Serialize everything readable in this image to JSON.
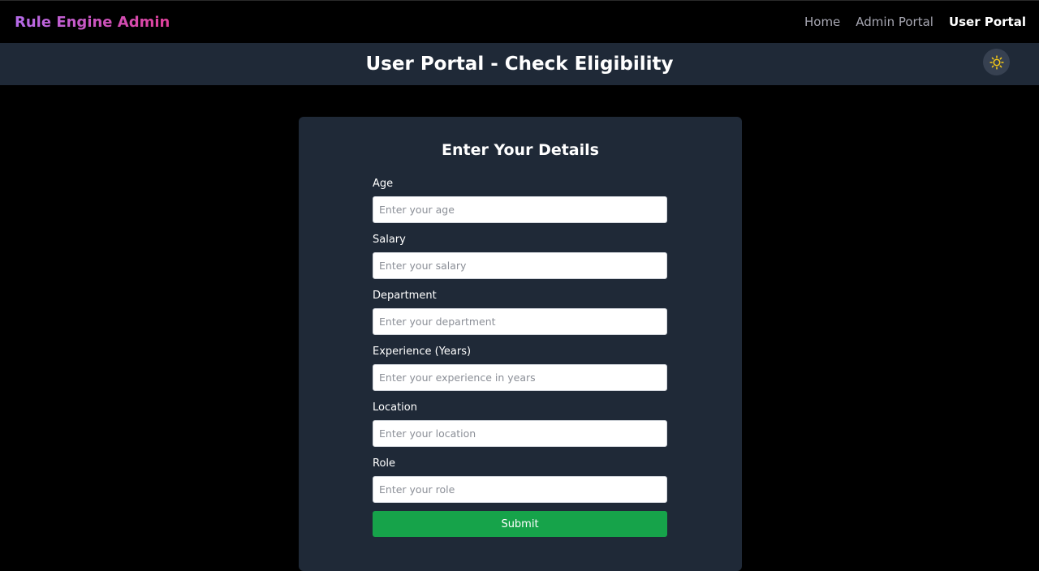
{
  "navbar": {
    "brand": "Rule Engine Admin",
    "links": [
      {
        "label": "Home",
        "active": false
      },
      {
        "label": "Admin Portal",
        "active": false
      },
      {
        "label": "User Portal",
        "active": true
      }
    ]
  },
  "header": {
    "title": "User Portal - Check Eligibility",
    "theme_icon": "sun-icon"
  },
  "form": {
    "title": "Enter Your Details",
    "fields": [
      {
        "label": "Age",
        "placeholder": "Enter your age",
        "value": ""
      },
      {
        "label": "Salary",
        "placeholder": "Enter your salary",
        "value": ""
      },
      {
        "label": "Department",
        "placeholder": "Enter your department",
        "value": ""
      },
      {
        "label": "Experience (Years)",
        "placeholder": "Enter your experience in years",
        "value": ""
      },
      {
        "label": "Location",
        "placeholder": "Enter your location",
        "value": ""
      },
      {
        "label": "Role",
        "placeholder": "Enter your role",
        "value": ""
      }
    ],
    "submit_label": "Submit"
  },
  "colors": {
    "page_bg": "#000000",
    "panel_bg": "#1f2937",
    "brand_gradient_start": "#b46be8",
    "brand_gradient_end": "#e0409a",
    "submit_bg": "#16a34a",
    "sun_icon": "#facc15"
  }
}
